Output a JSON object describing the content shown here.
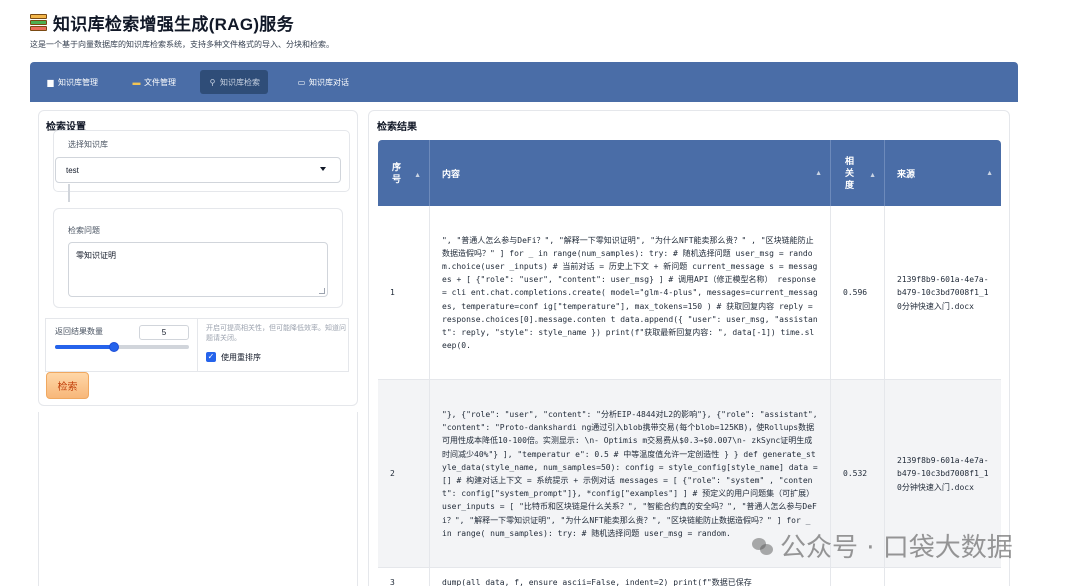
{
  "header": {
    "title": "知识库检索增强生成(RAG)服务",
    "subtitle": "这是一个基于向量数据库的知识库检索系统，支持多种文件格式的导入、分块和检索。"
  },
  "tabs": [
    {
      "label": "知识库管理",
      "icon": "database-icon"
    },
    {
      "label": "文件管理",
      "icon": "folder-icon"
    },
    {
      "label": "知识库检索",
      "icon": "magnifier-icon"
    },
    {
      "label": "知识库对话",
      "icon": "chat-icon"
    }
  ],
  "active_tab": "知识库检索",
  "search_settings": {
    "heading": "检索设置",
    "kb_label": "选择知识库",
    "kb_value": "test",
    "question_label": "检索问题",
    "question_value": "零知识证明",
    "count_label": "返回结果数量",
    "count_value": "5",
    "count_slider_fraction": 0.44,
    "hint": "开启可提高相关性，但可能降低效率。知道问题请关闭。",
    "rerank_label": "使用重排序",
    "rerank_checked": true,
    "search_button": "检索"
  },
  "results": {
    "heading": "检索结果",
    "columns": [
      "序号",
      "内容",
      "相关度",
      "来源"
    ],
    "rows": [
      {
        "index": "1",
        "content": "\", \"普通人怎么参与DeFi？\", \"解释一下零知识证明\", \"为什么NFT能卖那么贵？\" , \"区块链能防止数据造假吗？\" ] for _ in range(num_samples): try: # 随机选择问题 user_msg = random.choice(user _inputs) # 当前对话 = 历史上下文 + 新问题 current_message s = messages + [ {\"role\": \"user\", \"content\": user_msg} ] # 调用API（修正模型名称） response = cli ent.chat.completions.create( model=\"glm-4-plus\", messages=current_messages, temperature=conf ig[\"temperature\"], max_tokens=150 ) # 获取回复内容 reply = response.choices[0].message.conten t data.append({ \"user\": user_msg, \"assistant\": reply, \"style\": style_name }) print(f\"获取最新回复内容: \", data[-1]) time.sl eep(0.",
        "score": "0.596",
        "source": "2139f8b9-601a-4e7a-b479-10c3bd7008f1_10分钟快速入门.docx"
      },
      {
        "index": "2",
        "content": "\"}, {\"role\": \"user\", \"content\": \"分析EIP-4844对L2的影响\"}, {\"role\": \"assistant\", \"content\": \"Proto-dankshardi ng通过引入blob携带交易(每个blob=125KB)，使Rollups数据可用性成本降低10-100倍。实测显示: \\n- Optimis m交易费从$0.3→$0.007\\n- zkSync证明生成时间减少40%\"} ], \"temperatur e\": 0.5 # 中等温度值允许一定创造性 } } def generate_style_data(style_name, num_samples=50): config = style_config[style_name] data = [] # 构建对话上下文 = 系统提示 + 示例对话 messages = [ {\"role\": \"system\" , \"content\": config[\"system_prompt\"]}, *config[\"examples\"] ] # 预定义的用户问题集（可扩展） user_inputs = [ \"比特币和区块链是什么关系？\", \"智能合约真的安全吗？\", \"普通人怎么参与DeFi？\", \"解释一下零知识证明\", \"为什么NFT能卖那么贵？\", \"区块链能防止数据造假吗？\" ] for _ in range( num_samples): try: # 随机选择问题 user_msg = random.",
        "score": "0.532",
        "source": "2139f8b9-601a-4e7a-b479-10c3bd7008f1_10分钟快速入门.docx"
      },
      {
        "index": "3",
        "content": "dump(all_data, f, ensure_ascii=False, indent=2) print(f\"数据已保存",
        "score": "",
        "source": ""
      }
    ]
  },
  "watermark": "公众号 · 口袋大数据",
  "colors": {
    "header_bar": "#4a6da7",
    "active_tab": "#2f4d78",
    "accent": "#2563eb",
    "search_button": "#f7b779"
  }
}
